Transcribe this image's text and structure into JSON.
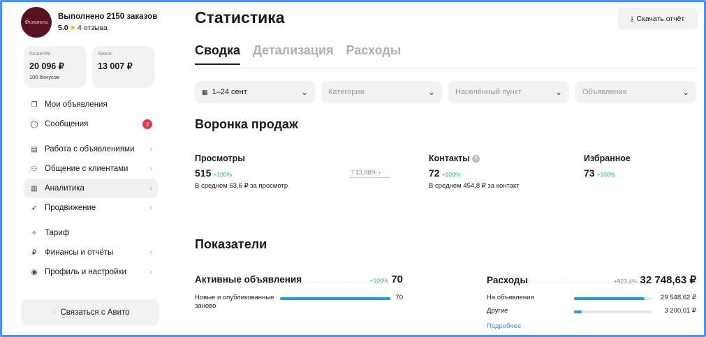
{
  "profile": {
    "avatar_text": "Финансы",
    "orders": "Выполнено 2150 заказов",
    "rating": "5.0",
    "reviews": "4 отзыва"
  },
  "wallets": [
    {
      "label": "Кошелёк",
      "value": "20 096 ₽",
      "sub": "100 бонусов"
    },
    {
      "label": "Аванс",
      "value": "13 007 ₽",
      "sub": ""
    }
  ],
  "nav": {
    "my_ads": "Мои объявления",
    "messages": "Сообщения",
    "messages_badge": "2",
    "ad_work": "Работа с объявлениями",
    "clients": "Общение с клиентами",
    "analytics": "Аналитика",
    "promotion": "Продвижение",
    "tariff": "Тариф",
    "finance": "Финансы и отчёты",
    "profile": "Профиль и настройки"
  },
  "contact_button": "Связаться с Авито",
  "page_title": "Статистика",
  "download_button": "Скачать отчёт",
  "tabs": [
    "Сводка",
    "Детализация",
    "Расходы"
  ],
  "filters": {
    "date": "1–24 сент",
    "category": "Категория",
    "city": "Населённый пункт",
    "ads": "Объявления"
  },
  "funnel": {
    "title": "Воронка продаж",
    "views": {
      "label": "Просмотры",
      "value": "515",
      "pct": "+100%",
      "avg": "В среднем 63,6 ₽ за просмотр"
    },
    "conversion": "13,98%",
    "contacts": {
      "label": "Контакты",
      "value": "72",
      "pct": "+100%",
      "avg": "В среднем 454,8 ₽ за контакт"
    },
    "favorites": {
      "label": "Избранное",
      "value": "73",
      "pct": "+100%"
    }
  },
  "indicators": {
    "title": "Показатели",
    "active": {
      "label": "Активные объявления",
      "pct": "+100%",
      "value": "70",
      "rows": [
        {
          "label": "Новые и опубликованные заново",
          "value": "70",
          "fraction": 1.0
        }
      ]
    },
    "expenses": {
      "label": "Расходы",
      "pct": "+923,4%",
      "value": "32 748,63 ₽",
      "rows": [
        {
          "label": "На объявления",
          "value": "29 548,62 ₽",
          "fraction": 0.9
        },
        {
          "label": "Другие",
          "value": "3 200,01 ₽",
          "fraction": 0.1
        }
      ],
      "more": "Подробнее"
    }
  }
}
